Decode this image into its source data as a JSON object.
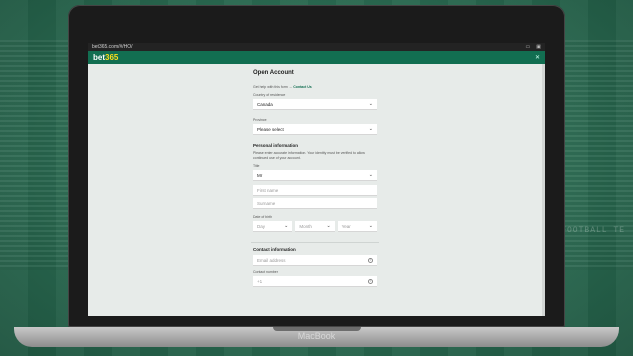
{
  "browser": {
    "url": "bet365.com/#/HO/",
    "icons": [
      "page-icon",
      "tab-icon"
    ]
  },
  "header": {
    "logo_text": "bet",
    "logo_num": "365",
    "close": "✕"
  },
  "form": {
    "title": "Open Account",
    "help_text": "Get help with this form →",
    "help_link": "Contact Us",
    "country_label": "Country of residence",
    "country_value": "Canada",
    "province_label": "Province",
    "province_value": "Please select",
    "personal_heading": "Personal information",
    "personal_para": "Please enter accurate information. Your identity must be verified to allow continued use of your account.",
    "title_label": "Title",
    "title_value": "Mr",
    "first_name_placeholder": "First name",
    "surname_placeholder": "Surname",
    "dob_label": "Date of birth",
    "dob_day": "Day",
    "dob_month": "Month",
    "dob_year": "Year",
    "contact_heading": "Contact information",
    "email_placeholder": "Email address",
    "contact_number_label": "Contact number",
    "phone_prefix": "+1"
  },
  "device": {
    "brand": "MacBook"
  },
  "background": {
    "board_text": "FOOTBALL TE"
  },
  "colors": {
    "brand_green": "#126e51",
    "logo_yellow": "#ffdf1b"
  }
}
